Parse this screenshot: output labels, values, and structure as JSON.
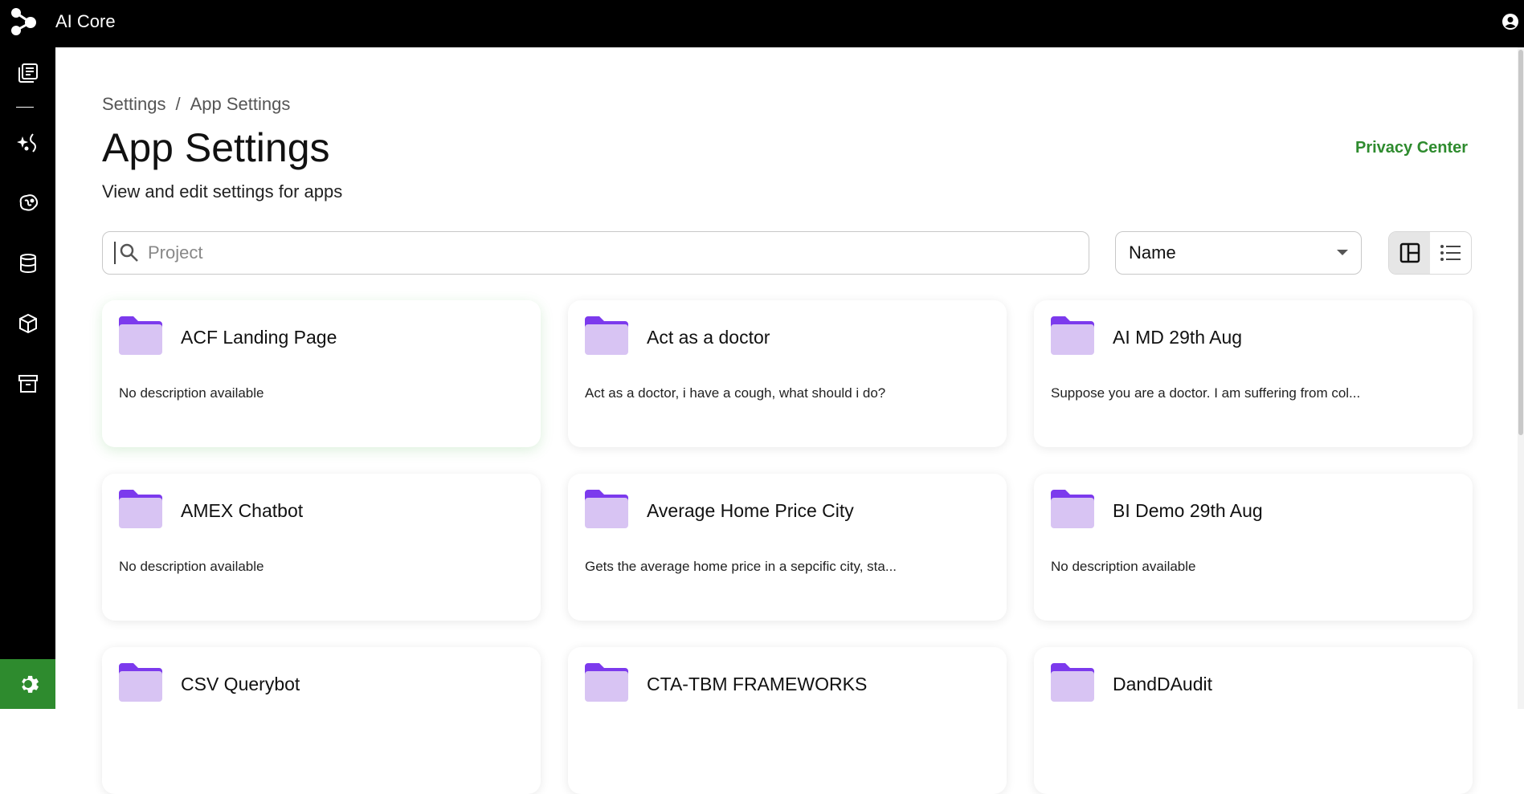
{
  "app": {
    "title": "AI Core"
  },
  "breadcrumb": {
    "root": "Settings",
    "separator": "/",
    "current": "App Settings"
  },
  "header": {
    "title": "App Settings",
    "subtitle": "View and edit settings for apps",
    "privacy_link": "Privacy Center"
  },
  "search": {
    "placeholder": "Project",
    "value": ""
  },
  "sort": {
    "selected": "Name"
  },
  "view": {
    "active": "grid"
  },
  "colors": {
    "accent": "#2e8b2e",
    "folder_back": "#7c3aed",
    "folder_front": "#d8c4f3"
  },
  "sidebar": {
    "items": [
      {
        "icon": "library-icon"
      },
      {
        "icon": "sparkle-wand-icon"
      },
      {
        "icon": "brain-icon"
      },
      {
        "icon": "database-icon"
      },
      {
        "icon": "cube-icon"
      },
      {
        "icon": "archive-icon"
      }
    ],
    "settings_icon": "gear-icon"
  },
  "projects": [
    {
      "title": "ACF Landing Page",
      "description": "No description available"
    },
    {
      "title": "Act as a doctor",
      "description": "Act as a doctor, i have a cough, what should i do?"
    },
    {
      "title": "AI MD 29th Aug",
      "description": "Suppose you are a doctor. I am suffering from col..."
    },
    {
      "title": "AMEX Chatbot",
      "description": "No description available"
    },
    {
      "title": "Average Home Price City",
      "description": "Gets the average home price in a sepcific city, sta..."
    },
    {
      "title": "BI Demo 29th Aug",
      "description": "No description available"
    },
    {
      "title": "CSV Querybot",
      "description": ""
    },
    {
      "title": "CTA-TBM FRAMEWORKS",
      "description": ""
    },
    {
      "title": "DandDAudit",
      "description": ""
    }
  ]
}
